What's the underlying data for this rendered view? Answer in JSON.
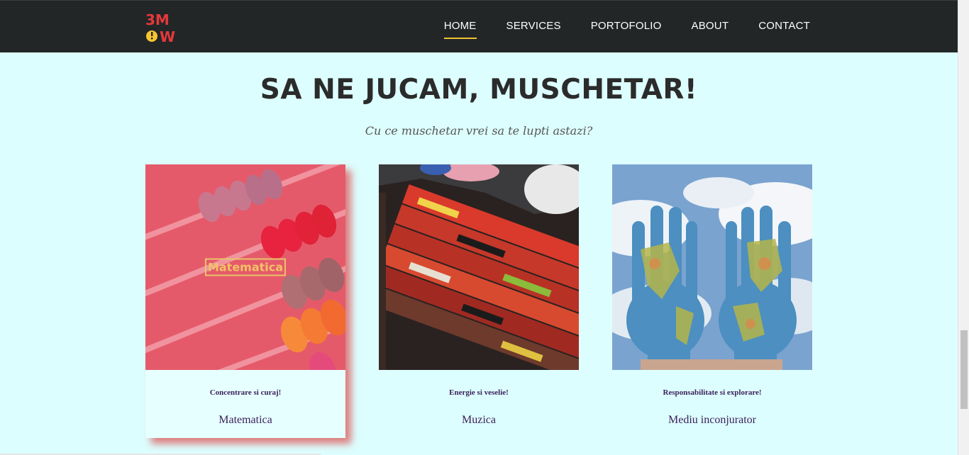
{
  "logo": {
    "text": "3MOW",
    "colors": [
      "#e5383b",
      "#f7c531"
    ]
  },
  "nav": {
    "items": [
      {
        "label": "HOME",
        "active": true
      },
      {
        "label": "SERVICES",
        "active": false
      },
      {
        "label": "PORTOFOLIO",
        "active": false
      },
      {
        "label": "ABOUT",
        "active": false
      },
      {
        "label": "CONTACT",
        "active": false
      }
    ]
  },
  "hero": {
    "title": "SA NE JUCAM, MUSCHETAR!",
    "subtitle": "Cu ce muschetar vrei sa te lupti astazi?"
  },
  "cards": [
    {
      "image": "abacus-photo",
      "overlay_label": "Matematica",
      "tag": "Concentrare si curaj!",
      "name": "Matematica"
    },
    {
      "image": "painted-piano-photo",
      "tag": "Energie si veselie!",
      "name": "Muzica"
    },
    {
      "image": "world-map-hands-photo",
      "tag": "Responsabilitate si explorare!",
      "name": "Mediu inconjurator"
    }
  ],
  "colors": {
    "navbar": "#222627",
    "accent": "#f1c232",
    "background": "#ddfefe",
    "card_text": "#3a1f5a"
  }
}
